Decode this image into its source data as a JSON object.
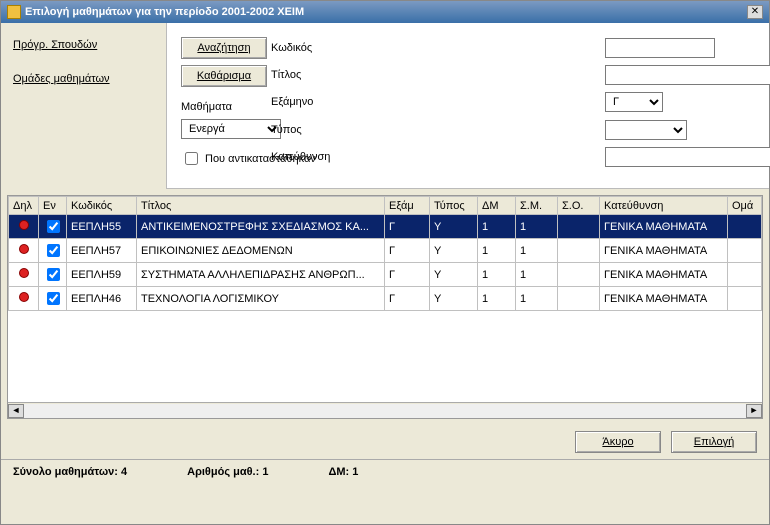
{
  "window": {
    "title": "Επιλογή μαθημάτων για την περίοδο 2001-2002 ΧΕΙΜ"
  },
  "sidebar": {
    "items": [
      {
        "label": "Πρόγρ. Σπουδών"
      },
      {
        "label": "Ομάδες μαθημάτων"
      }
    ]
  },
  "form": {
    "code_label": "Κωδικός",
    "code_value": "",
    "title_label": "Τίτλος",
    "title_value": "",
    "semester_label": "Εξάμηνο",
    "semester_value": "Γ",
    "type_label": "Τύπος",
    "type_value": "",
    "direction_label": "Κατεύθυνση",
    "direction_value": ""
  },
  "actions": {
    "search": "Αναζήτηση",
    "clear": "Καθάρισμα",
    "courses_label": "Μαθήματα",
    "courses_value": "Ενεργά",
    "replaced_label": "Που αντικαταστάθηκαν"
  },
  "grid": {
    "headers": {
      "dhl": "Δηλ",
      "en": "Εν",
      "code": "Κωδικός",
      "title": "Τίτλος",
      "sem": "Εξάμ",
      "type": "Τύπος",
      "dm": "ΔΜ",
      "sm": "Σ.Μ.",
      "so": "Σ.Ο.",
      "direction": "Κατεύθυνση",
      "group": "Ομά"
    },
    "rows": [
      {
        "en": true,
        "code": "ΕΕΠΛΗ55",
        "title": "ΑΝΤΙΚΕΙΜΕΝΟΣΤΡΕΦΗΣ ΣΧΕΔΙΑΣΜΟΣ ΚΑ...",
        "sem": "Γ",
        "type": "Υ",
        "dm": "1",
        "sm": "1",
        "so": "",
        "direction": "ΓΕΝΙΚΑ ΜΑΘΗΜΑΤΑ",
        "selected": true
      },
      {
        "en": true,
        "code": "ΕΕΠΛΗ57",
        "title": "ΕΠΙΚΟΙΝΩΝΙΕΣ ΔΕΔΟΜΕΝΩΝ",
        "sem": "Γ",
        "type": "Υ",
        "dm": "1",
        "sm": "1",
        "so": "",
        "direction": "ΓΕΝΙΚΑ ΜΑΘΗΜΑΤΑ"
      },
      {
        "en": true,
        "code": "ΕΕΠΛΗ59",
        "title": "ΣΥΣΤΗΜΑΤΑ ΑΛΛΗΛΕΠΙΔΡΑΣΗΣ ΑΝΘΡΩΠ...",
        "sem": "Γ",
        "type": "Υ",
        "dm": "1",
        "sm": "1",
        "so": "",
        "direction": "ΓΕΝΙΚΑ ΜΑΘΗΜΑΤΑ"
      },
      {
        "en": true,
        "code": "ΕΕΠΛΗ46",
        "title": "ΤΕΧΝΟΛΟΓΙΑ ΛΟΓΙΣΜΙΚΟΥ",
        "sem": "Γ",
        "type": "Υ",
        "dm": "1",
        "sm": "1",
        "so": "",
        "direction": "ΓΕΝΙΚΑ ΜΑΘΗΜΑΤΑ"
      }
    ]
  },
  "footer": {
    "cancel": "Άκυρο",
    "select": "Επιλογή"
  },
  "status": {
    "total_label": "Σύνολο μαθημάτων:",
    "total_value": "4",
    "count_label": "Αριθμός μαθ.:",
    "count_value": "1",
    "dm_label": "ΔΜ:",
    "dm_value": "1"
  }
}
